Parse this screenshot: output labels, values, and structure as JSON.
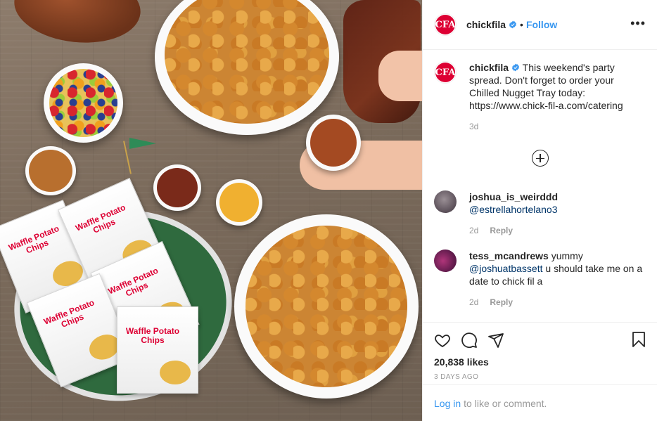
{
  "header": {
    "username": "chickfila",
    "dot": "•",
    "follow_label": "Follow",
    "more_label": "•••",
    "avatar_glyph": "CFA"
  },
  "caption": {
    "username": "chickfila",
    "text": "This weekend's party spread. Don't forget to order your Chilled Nugget Tray today: https://www.chick-fil-a.com/catering",
    "time": "3d"
  },
  "comments": [
    {
      "username": "joshua_is_weirddd",
      "text": "",
      "mention": "@estrellahortelano3",
      "after": "",
      "time": "2d",
      "reply_label": "Reply"
    },
    {
      "username": "tess_mcandrews",
      "text": "yummy",
      "mention": "@joshuatbassett",
      "after": "u should take me on a date to chick fil a",
      "time": "2d",
      "reply_label": "Reply"
    }
  ],
  "photo": {
    "bag_text": "Waffle Potato Chips"
  },
  "actions": {
    "likes": "20,838 likes",
    "date": "3 DAYS AGO"
  },
  "login": {
    "link_label": "Log in",
    "text": "to like or comment."
  },
  "colors": {
    "brand_red": "#dd0033",
    "link_blue": "#3897f0",
    "verified_blue": "#3897f0"
  },
  "icons": [
    "heart-icon",
    "comment-icon",
    "share-icon",
    "bookmark-icon",
    "verified-icon",
    "more-options-icon",
    "load-more-icon"
  ]
}
